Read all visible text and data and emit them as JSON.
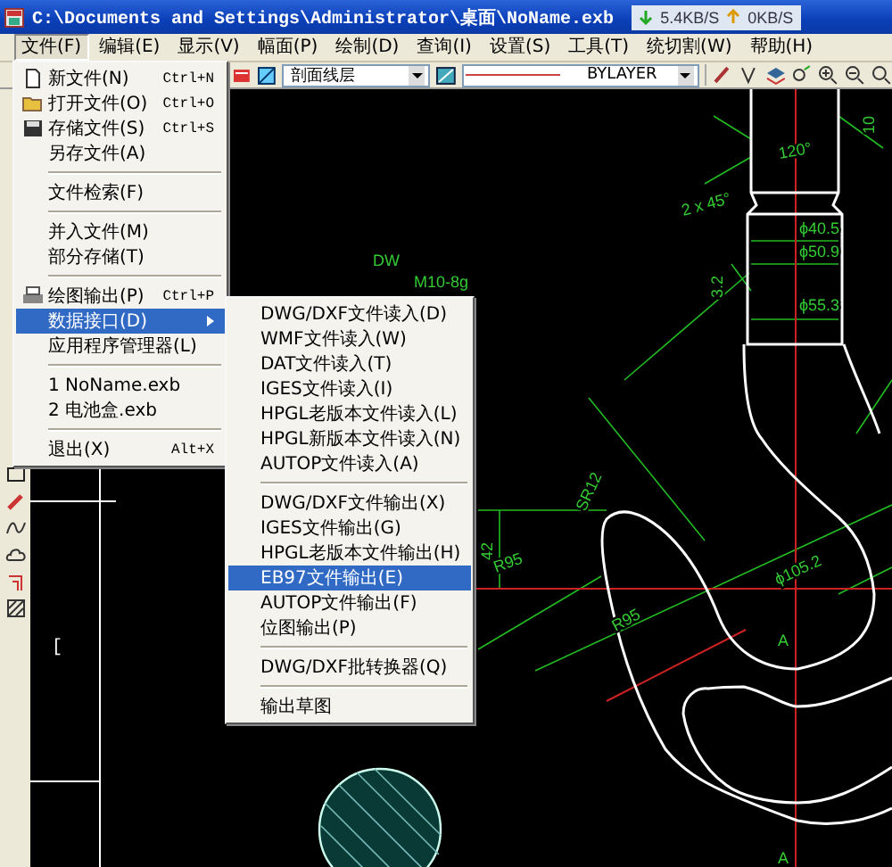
{
  "window": {
    "title": "C:\\Documents and Settings\\Administrator\\桌面\\NoName.exb"
  },
  "network_meter": {
    "download": "5.4KB/S",
    "upload": "0KB/S"
  },
  "menubar": [
    {
      "label": "文件(F)",
      "selected": true
    },
    {
      "label": "编辑(E)",
      "selected": false
    },
    {
      "label": "显示(V)",
      "selected": false
    },
    {
      "label": "幅面(P)",
      "selected": false
    },
    {
      "label": "绘制(D)",
      "selected": false
    },
    {
      "label": "查询(I)",
      "selected": false
    },
    {
      "label": "设置(S)",
      "selected": false
    },
    {
      "label": "工具(T)",
      "selected": false
    },
    {
      "label": "统切割(W)",
      "selected": false
    },
    {
      "label": "帮助(H)",
      "selected": false
    }
  ],
  "toolbar": {
    "layer": "剖面线层",
    "linetype": "BYLAYER"
  },
  "file_menu": {
    "items": [
      {
        "kind": "item",
        "label": "新文件(N)",
        "shortcut": "Ctrl+N",
        "selected": false
      },
      {
        "kind": "item",
        "label": "打开文件(O)",
        "shortcut": "Ctrl+O",
        "selected": false
      },
      {
        "kind": "item",
        "label": "存储文件(S)",
        "shortcut": "Ctrl+S",
        "selected": false
      },
      {
        "kind": "item",
        "label": "另存文件(A)",
        "selected": false
      },
      {
        "kind": "separator"
      },
      {
        "kind": "item",
        "label": "文件检索(F)",
        "selected": false
      },
      {
        "kind": "separator"
      },
      {
        "kind": "item",
        "label": "并入文件(M)",
        "selected": false
      },
      {
        "kind": "item",
        "label": "部分存储(T)",
        "selected": false
      },
      {
        "kind": "separator"
      },
      {
        "kind": "item",
        "label": "绘图输出(P)",
        "shortcut": "Ctrl+P",
        "selected": false
      },
      {
        "kind": "submenu",
        "label": "数据接口(D)",
        "selected": true
      },
      {
        "kind": "item",
        "label": "应用程序管理器(L)",
        "selected": false
      },
      {
        "kind": "separator"
      },
      {
        "kind": "item",
        "label": "1 NoName.exb",
        "selected": false
      },
      {
        "kind": "item",
        "label": "2 电池盒.exb",
        "selected": false
      },
      {
        "kind": "separator"
      },
      {
        "kind": "item",
        "label": "退出(X)",
        "shortcut": "Alt+X",
        "selected": false
      }
    ]
  },
  "data_submenu": {
    "items": [
      {
        "kind": "item",
        "label": "DWG/DXF文件读入(D)",
        "selected": false
      },
      {
        "kind": "item",
        "label": "WMF文件读入(W)",
        "selected": false
      },
      {
        "kind": "item",
        "label": "DAT文件读入(T)",
        "selected": false
      },
      {
        "kind": "item",
        "label": "IGES文件读入(I)",
        "selected": false
      },
      {
        "kind": "item",
        "label": "HPGL老版本文件读入(L)",
        "selected": false
      },
      {
        "kind": "item",
        "label": "HPGL新版本文件读入(N)",
        "selected": false
      },
      {
        "kind": "item",
        "label": "AUTOP文件读入(A)",
        "selected": false
      },
      {
        "kind": "separator"
      },
      {
        "kind": "item",
        "label": "DWG/DXF文件输出(X)",
        "selected": false
      },
      {
        "kind": "item",
        "label": "IGES文件输出(G)",
        "selected": false
      },
      {
        "kind": "item",
        "label": "HPGL老版本文件输出(H)",
        "selected": false
      },
      {
        "kind": "item",
        "label": "EB97文件输出(E)",
        "selected": true
      },
      {
        "kind": "item",
        "label": "AUTOP文件输出(F)",
        "selected": false
      },
      {
        "kind": "item",
        "label": "位图输出(P)",
        "selected": false
      },
      {
        "kind": "separator"
      },
      {
        "kind": "item",
        "label": "DWG/DXF批转换器(Q)",
        "selected": false
      },
      {
        "kind": "separator"
      },
      {
        "kind": "item",
        "label": "输出草图",
        "selected": false
      }
    ]
  },
  "drawing": {
    "labels": [
      "DW",
      "M10-8g",
      "120°",
      "2 x 45°",
      "ϕ40.5",
      "ϕ50.9",
      "ϕ55.3",
      "10",
      "3.2",
      "R95",
      "SR12",
      "42",
      "R95",
      "ϕ105.2",
      "A",
      "A"
    ],
    "cursor_mark": "["
  }
}
